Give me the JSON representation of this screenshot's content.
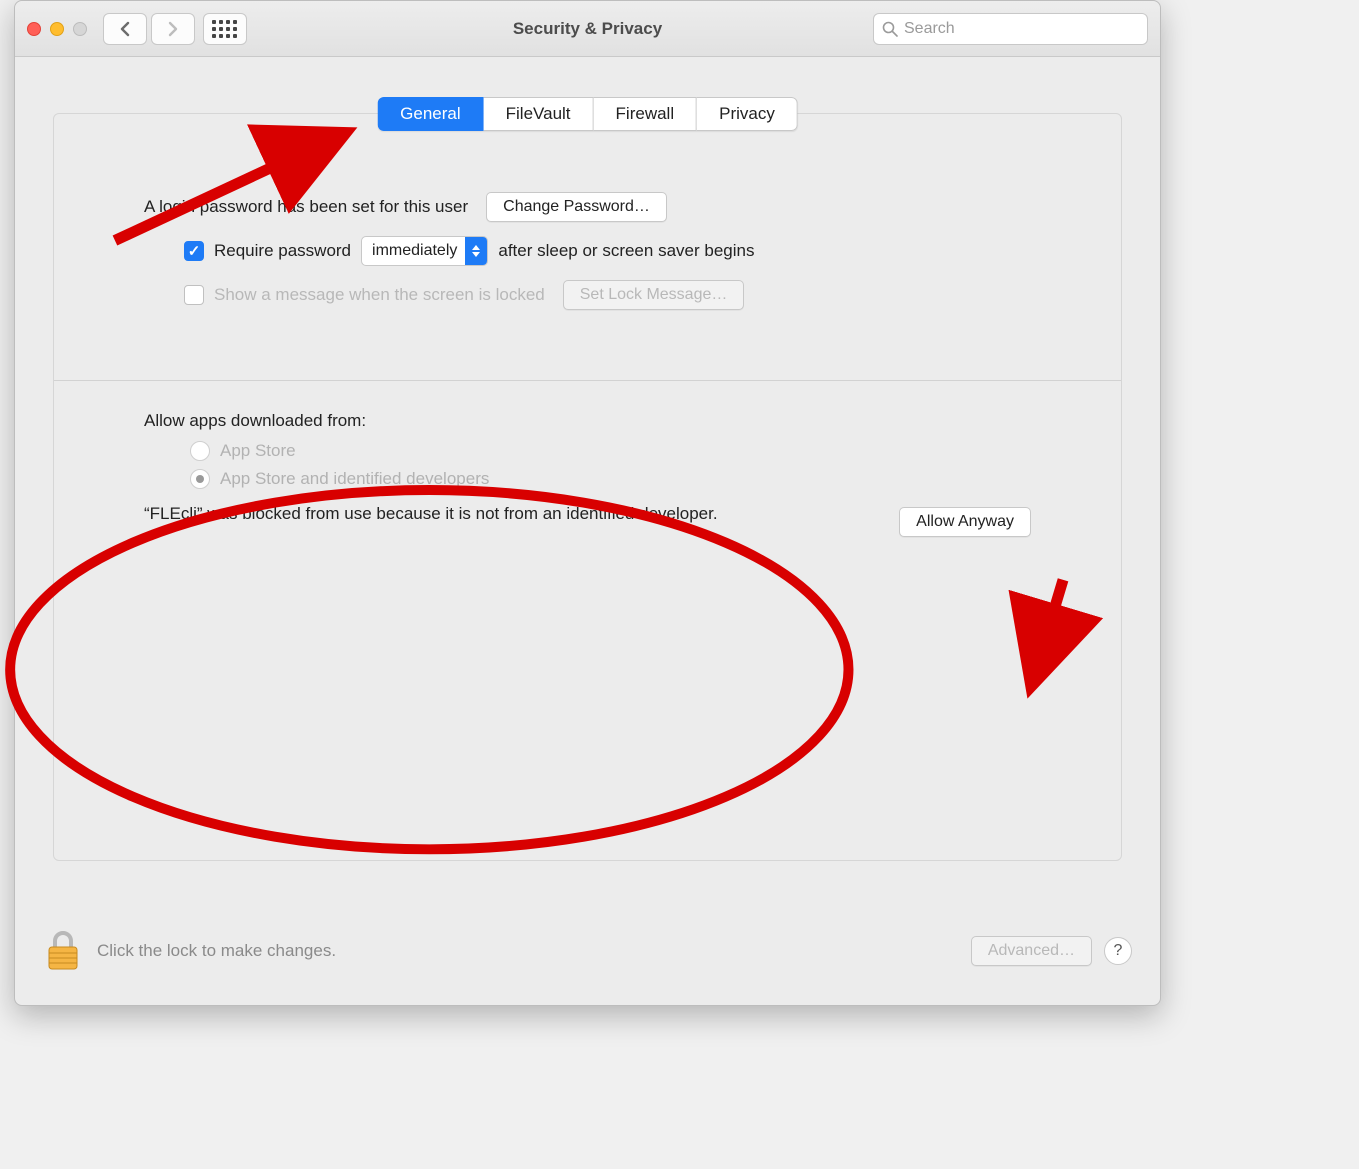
{
  "titlebar": {
    "title": "Security & Privacy",
    "search_placeholder": "Search"
  },
  "tabs": {
    "items": [
      "General",
      "FileVault",
      "Firewall",
      "Privacy"
    ],
    "active_index": 0
  },
  "general": {
    "login_password_text": "A login password has been set for this user",
    "change_password_label": "Change Password…",
    "require_password_checked": true,
    "require_password_label": "Require password",
    "require_password_delay": "immediately",
    "require_password_suffix": "after sleep or screen saver begins",
    "show_message_checked": false,
    "show_message_label": "Show a message when the screen is locked",
    "set_lock_message_label": "Set Lock Message…",
    "allow_apps_heading": "Allow apps downloaded from:",
    "radio_options": [
      "App Store",
      "App Store and identified developers"
    ],
    "radio_selected_index": 1,
    "blocked_message": "“FLEcli” was blocked from use because it is not from an identified developer.",
    "allow_anyway_label": "Allow Anyway"
  },
  "footer": {
    "lock_hint": "Click the lock to make changes.",
    "advanced_label": "Advanced…",
    "help_label": "?"
  },
  "annotations": {
    "arrow_to_general_tab": true,
    "ellipse_around_allow_apps": true,
    "arrow_to_allow_anyway": true,
    "color": "#d80000"
  }
}
